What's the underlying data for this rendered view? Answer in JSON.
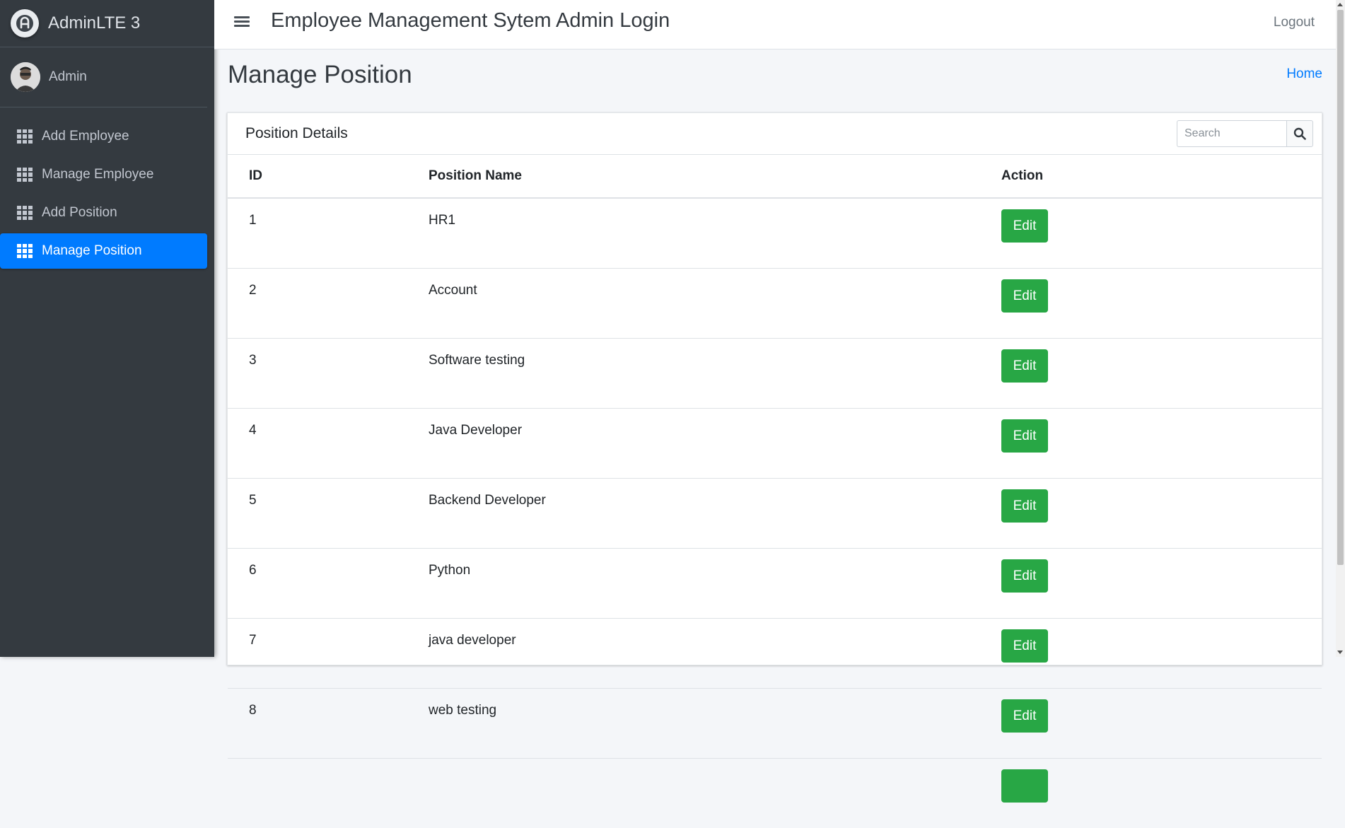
{
  "brand": {
    "name": "AdminLTE 3",
    "logo_icon": "adminlte-logo-icon"
  },
  "user": {
    "name": "Admin"
  },
  "sidebar": {
    "items": [
      {
        "label": "Add Employee",
        "icon": "grid-icon",
        "active": false
      },
      {
        "label": "Manage Employee",
        "icon": "grid-icon",
        "active": false
      },
      {
        "label": "Add Position",
        "icon": "grid-icon",
        "active": false
      },
      {
        "label": "Manage Position",
        "icon": "grid-icon",
        "active": true
      }
    ]
  },
  "navbar": {
    "title": "Employee Management Sytem Admin Login",
    "logout": "Logout"
  },
  "page": {
    "title": "Manage Position",
    "breadcrumb_home": "Home"
  },
  "card": {
    "title": "Position Details",
    "search_placeholder": "Search",
    "columns": [
      "ID",
      "Position Name",
      "Action"
    ],
    "edit_label": "Edit",
    "rows": [
      {
        "id": "1",
        "name": "HR1"
      },
      {
        "id": "2",
        "name": "Account"
      },
      {
        "id": "3",
        "name": "Software testing"
      },
      {
        "id": "4",
        "name": "Java Developer"
      },
      {
        "id": "5",
        "name": "Backend Developer"
      },
      {
        "id": "6",
        "name": "Python"
      },
      {
        "id": "7",
        "name": "java developer"
      },
      {
        "id": "8",
        "name": "web testing"
      },
      {
        "id": "",
        "name": ""
      }
    ]
  },
  "colors": {
    "sidebar_bg": "#343a40",
    "active_nav": "#007bff",
    "edit_button": "#28a745",
    "link": "#007bff"
  }
}
